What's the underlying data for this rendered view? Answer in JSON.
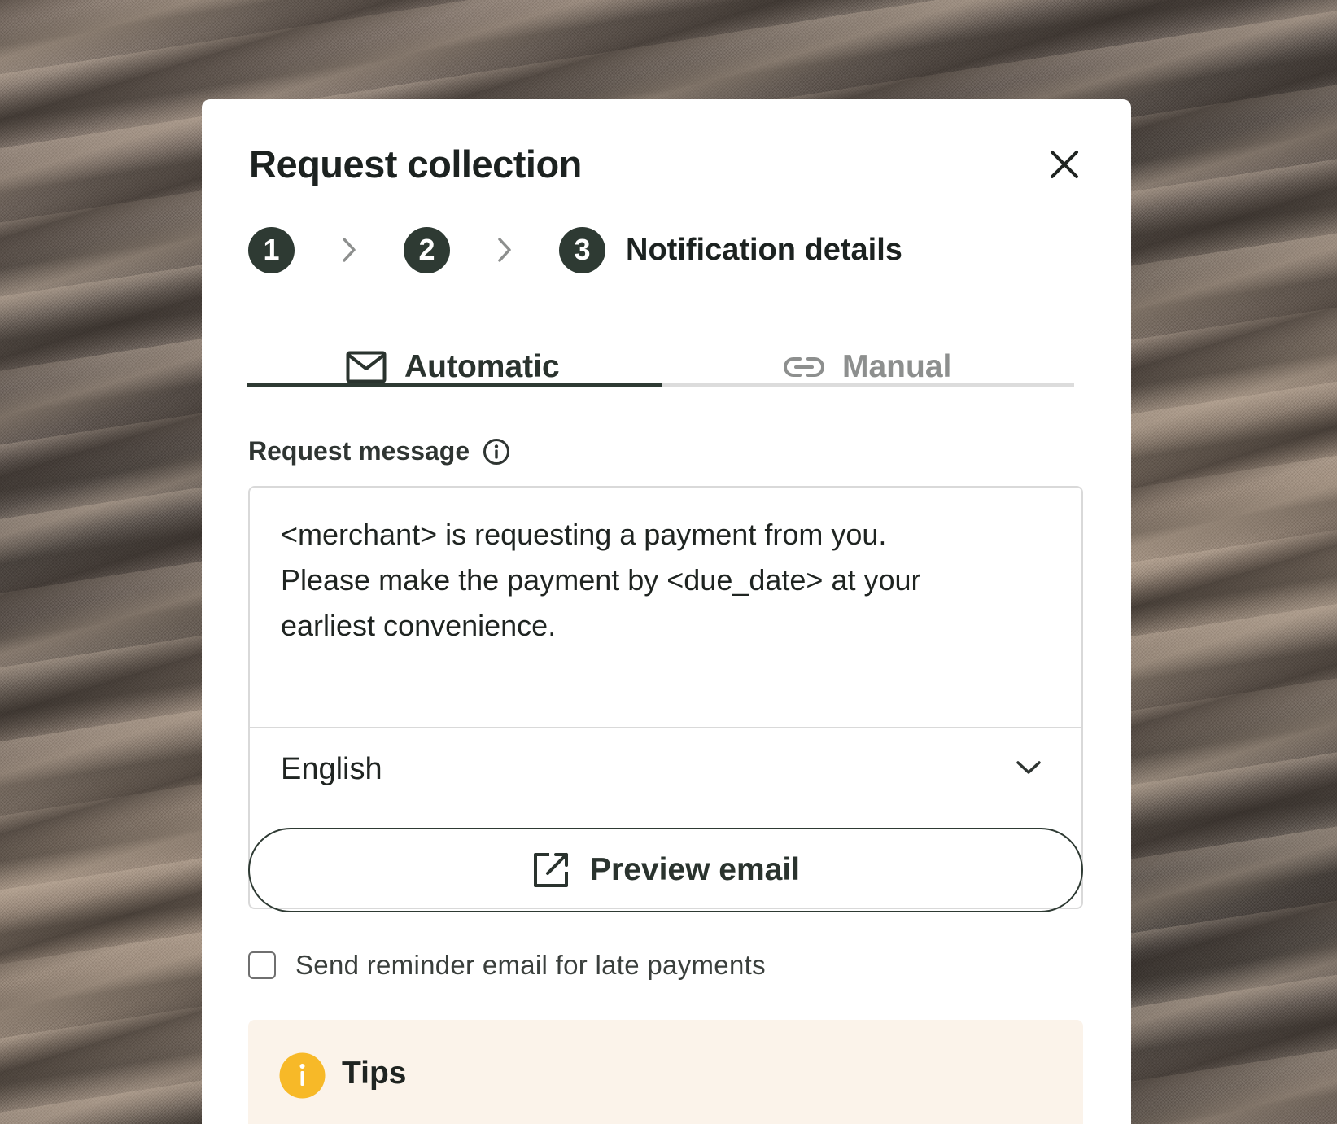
{
  "dialog": {
    "title": "Request collection"
  },
  "stepper": {
    "steps": [
      {
        "number": "1"
      },
      {
        "number": "2"
      },
      {
        "number": "3",
        "label": "Notification details"
      }
    ]
  },
  "tabs": [
    {
      "label": "Automatic",
      "icon": "mail-icon",
      "active": true
    },
    {
      "label": "Manual",
      "icon": "link-icon",
      "active": false
    }
  ],
  "request_message": {
    "label": "Request message",
    "value": "<merchant> is requesting a payment from you.\nPlease make the payment by <due_date> at your\nearliest convenience.",
    "language": "English"
  },
  "preview_button": {
    "label": "Preview email",
    "icon": "external-link-icon"
  },
  "reminder": {
    "label": "Send reminder email for late payments",
    "checked": false
  },
  "tips": {
    "title": "Tips",
    "icon": "info-icon"
  },
  "colors": {
    "primary": "#2e3a33",
    "tips_background": "#fbf3ea",
    "tips_icon": "#f7b928",
    "inactive_tab": "#8d8f8e"
  }
}
